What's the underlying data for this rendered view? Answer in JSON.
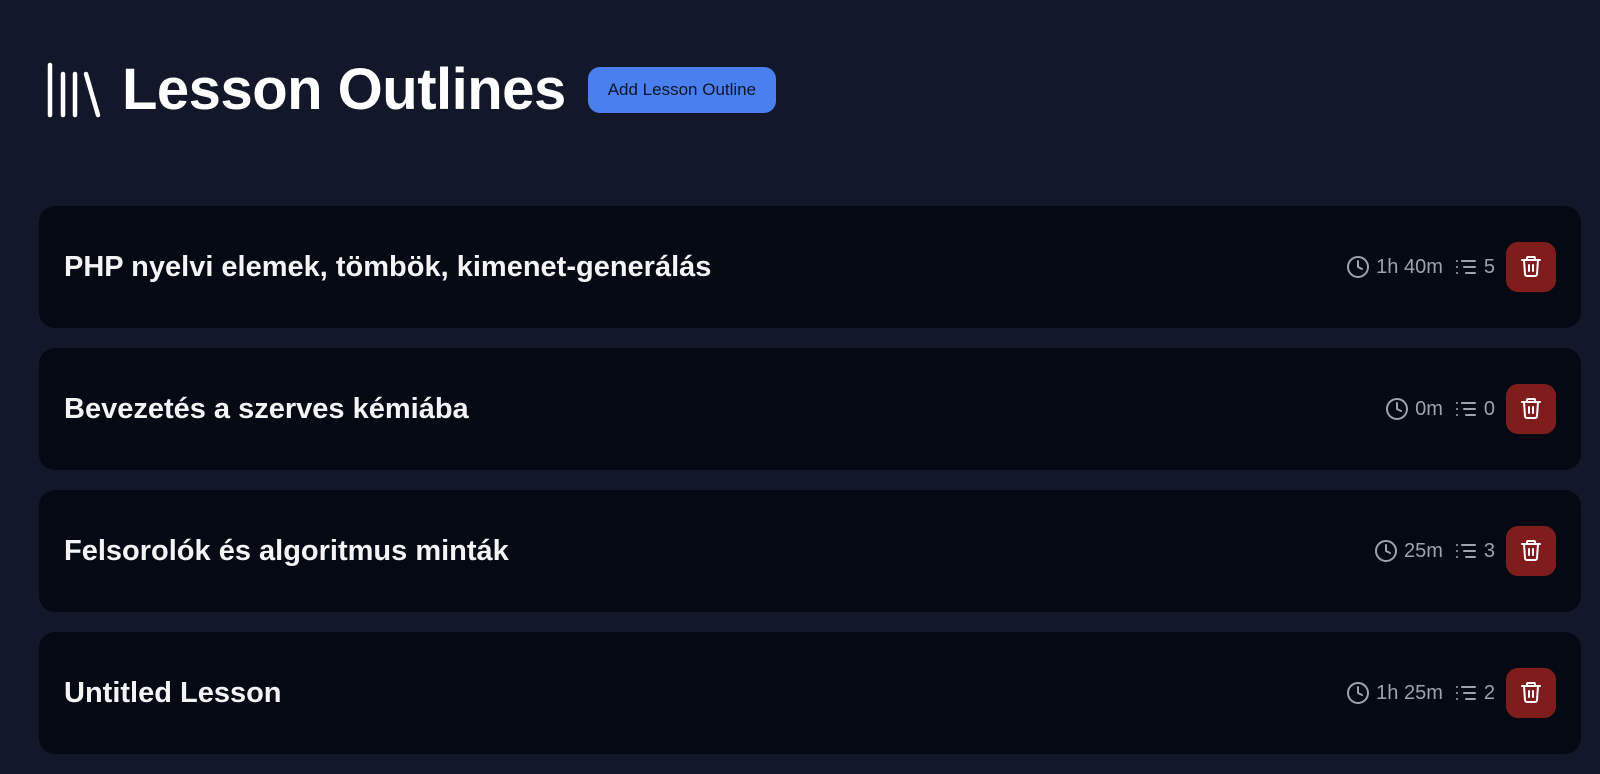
{
  "header": {
    "icon": "library-icon",
    "title": "Lesson Outlines",
    "add_button_label": "Add Lesson Outline"
  },
  "colors": {
    "background": "#121729",
    "card": "#050914",
    "accent": "#4a7fee",
    "danger": "#7f1d1d",
    "muted": "#9ca3af"
  },
  "lessons": [
    {
      "title": "PHP nyelvi elemek, tömbök, kimenet-generálás",
      "duration": "1h 40m",
      "sections": "5"
    },
    {
      "title": "Bevezetés a szerves kémiába",
      "duration": "0m",
      "sections": "0"
    },
    {
      "title": "Felsorolók és algoritmus minták",
      "duration": "25m",
      "sections": "3"
    },
    {
      "title": "Untitled Lesson",
      "duration": "1h 25m",
      "sections": "2"
    }
  ]
}
